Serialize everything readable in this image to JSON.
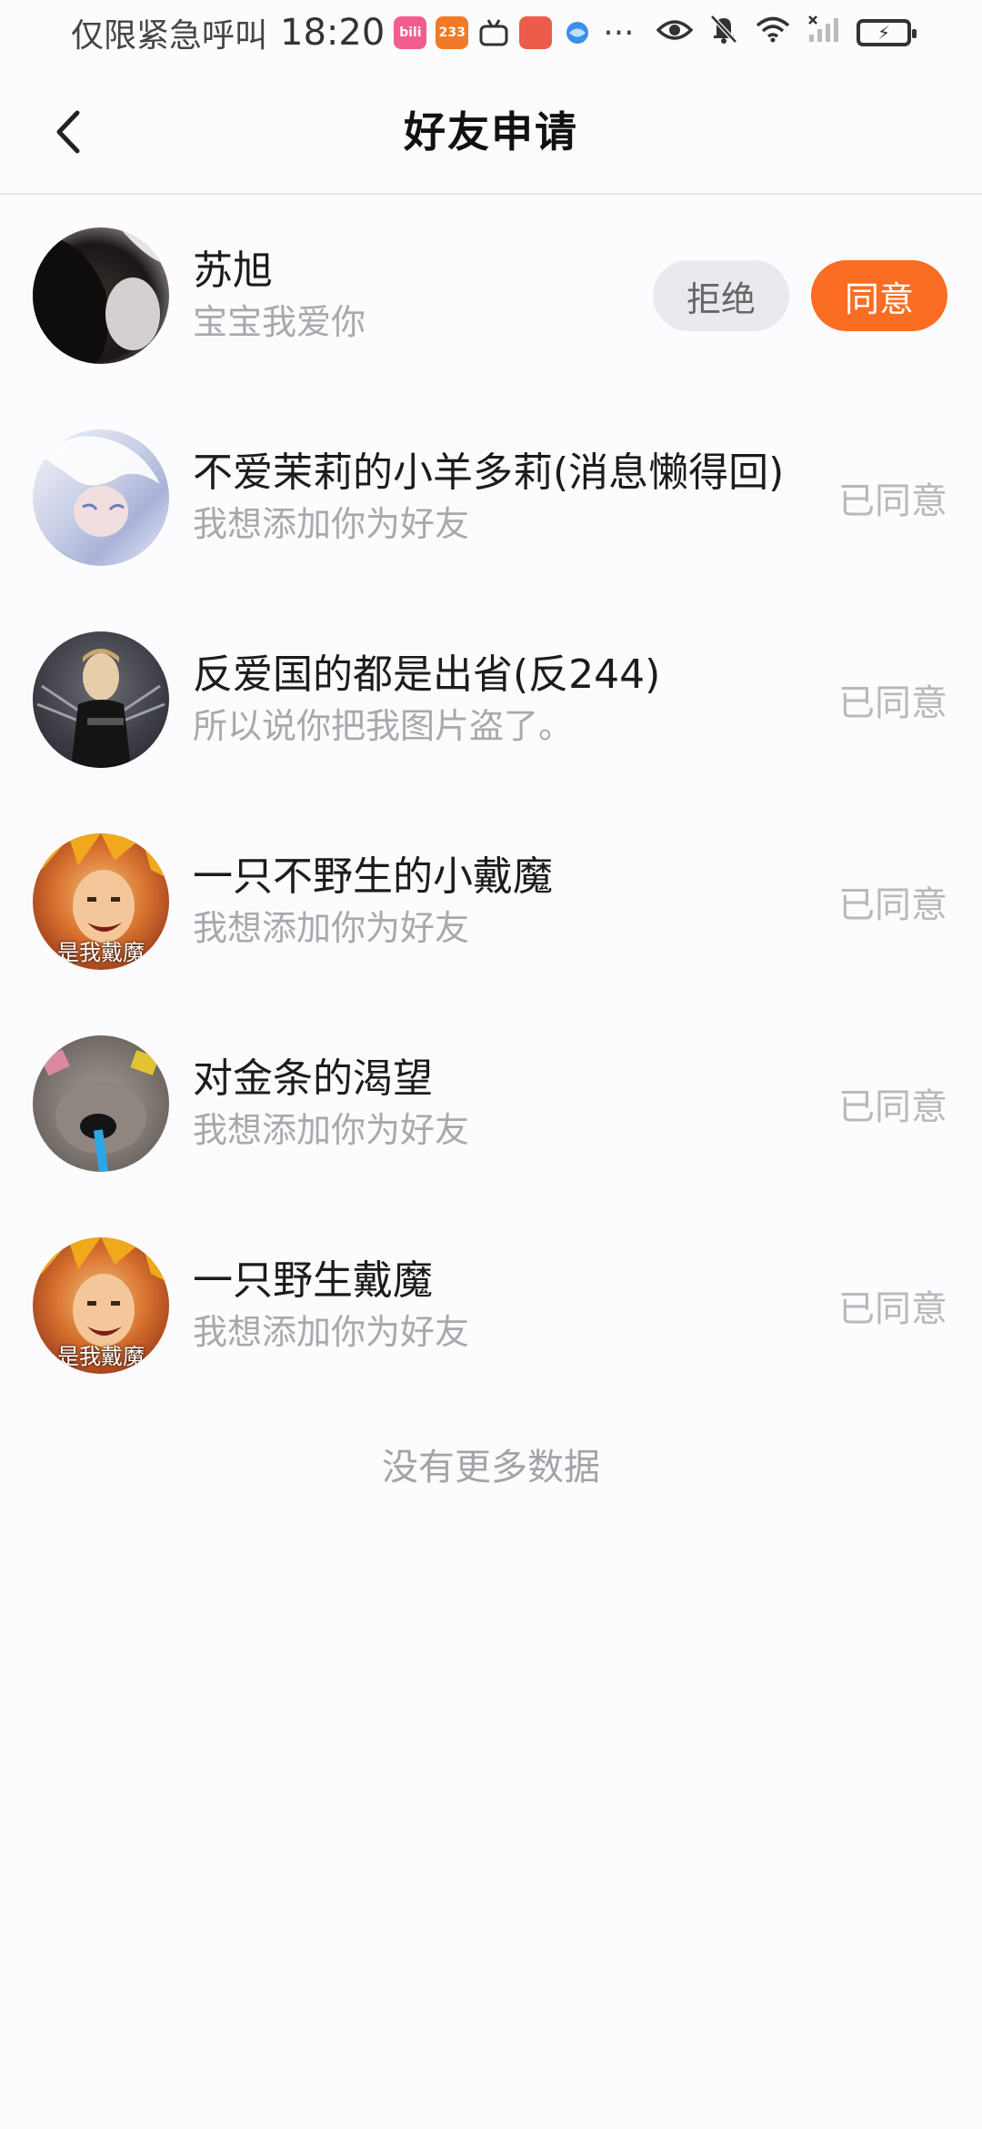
{
  "status_bar": {
    "carrier": "仅限紧急呼叫",
    "time": "18:20",
    "apps": [
      {
        "name": "bilibili-icon",
        "text": "bili",
        "color": "#f25d8e"
      },
      {
        "name": "app-233-icon",
        "text": "233",
        "color": "#f07a28"
      },
      {
        "name": "tv-icon",
        "text": "",
        "color": "#333333"
      },
      {
        "name": "shopping-icon",
        "text": "",
        "color": "#ec5c4b"
      },
      {
        "name": "browser-icon",
        "text": "",
        "color": "#3a8fe8"
      }
    ],
    "more": "···"
  },
  "header": {
    "title": "好友申请"
  },
  "requests": [
    {
      "name": "苏旭",
      "message": "宝宝我爱你",
      "status": "",
      "reject_label": "拒绝",
      "accept_label": "同意",
      "avatar_color": "#1b1717",
      "avatar_label": ""
    },
    {
      "name": "不爱茉莉的小羊多莉(消息懒得回)",
      "message": "我想添加你为好友",
      "status": "已同意",
      "avatar_color": "#d7dced",
      "avatar_label": ""
    },
    {
      "name": "反爱国的都是出省(反244)",
      "message": "所以说你把我图片盗了。",
      "status": "已同意",
      "avatar_color": "#3b3c44",
      "avatar_label": ""
    },
    {
      "name": "一只不野生的小戴魔",
      "message": "我想添加你为好友",
      "status": "已同意",
      "avatar_color": "#c5542a",
      "avatar_label": "是我戴魔"
    },
    {
      "name": "对金条的渴望",
      "message": "我想添加你为好友",
      "status": "已同意",
      "avatar_color": "#7d7570",
      "avatar_label": ""
    },
    {
      "name": "一只野生戴魔",
      "message": "我想添加你为好友",
      "status": "已同意",
      "avatar_color": "#c5542a",
      "avatar_label": "是我戴魔"
    }
  ],
  "footer": {
    "no_more": "没有更多数据"
  }
}
